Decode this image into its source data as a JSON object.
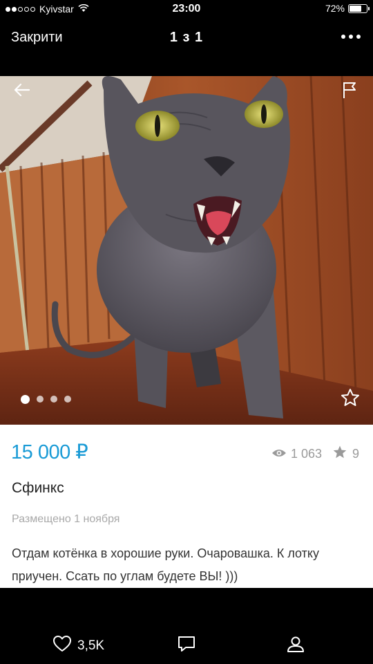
{
  "status": {
    "carrier": "Kyivstar",
    "time": "23:00",
    "battery": "72%",
    "battery_level": 0.72
  },
  "header": {
    "close_label": "Закрити",
    "counter": "1 з 1"
  },
  "listing": {
    "price": "15 000 ₽",
    "views": "1 063",
    "favorites": "9",
    "title": "Сфинкс",
    "posted": "Размещено 1 ноября",
    "description": "Отдам котёнка в хорошие руки. Очаровашка. К лотку приучен. Ссать по углам будете ВЫ! )))",
    "photo_count": 4,
    "photo_index": 1
  },
  "bottom": {
    "likes": "3,5K"
  },
  "icons": {
    "back": "arrow-left-icon",
    "flag": "flag-icon",
    "favorite": "star-icon",
    "views": "eye-icon",
    "likes": "heart-icon",
    "comment": "speech-bubble-icon",
    "profile": "person-icon"
  },
  "colors": {
    "price": "#1a9bd6",
    "muted": "#9a9a9a"
  }
}
